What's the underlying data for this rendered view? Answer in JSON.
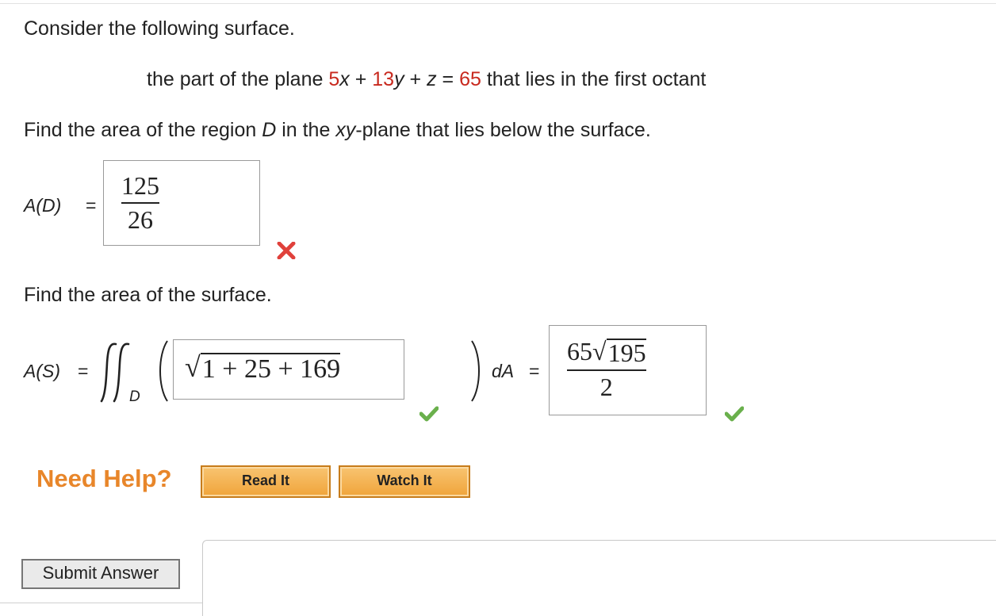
{
  "intro": "Consider the following surface.",
  "surface": {
    "prefix": "the part of the plane ",
    "c1": "5",
    "x": "x",
    "plus1": " + ",
    "c2": "13",
    "y": "y",
    "plus2": " + ",
    "z": "z",
    "eq": " = ",
    "c3": "65",
    "suffix": " that lies in the first octant"
  },
  "q1": {
    "pre": "Find the area of the region ",
    "D": "D",
    "mid": " in the ",
    "xy": "xy",
    "post": "-plane that lies below the surface.",
    "label": "A(D)",
    "equals": "=",
    "answer_num": "125",
    "answer_den": "26",
    "status": "incorrect"
  },
  "q2": {
    "text": "Find the area of the surface.",
    "label": "A(S)",
    "equals": "=",
    "integral_sub": "D",
    "integrand_parts": [
      "1 + 25 + 169"
    ],
    "dA": "dA",
    "equals2": "=",
    "answer_num_coef": "65",
    "answer_num_rad": "195",
    "answer_den": "2",
    "integrand_status": "correct",
    "answer_status": "correct"
  },
  "help": {
    "label": "Need Help?",
    "read_label": "Read It",
    "watch_label": "Watch It"
  },
  "submit_label": "Submit Answer",
  "colors": {
    "highlight": "#c8291e",
    "help_text": "#e8862a",
    "check": "#6ab04c",
    "cross": "#e0413b"
  }
}
